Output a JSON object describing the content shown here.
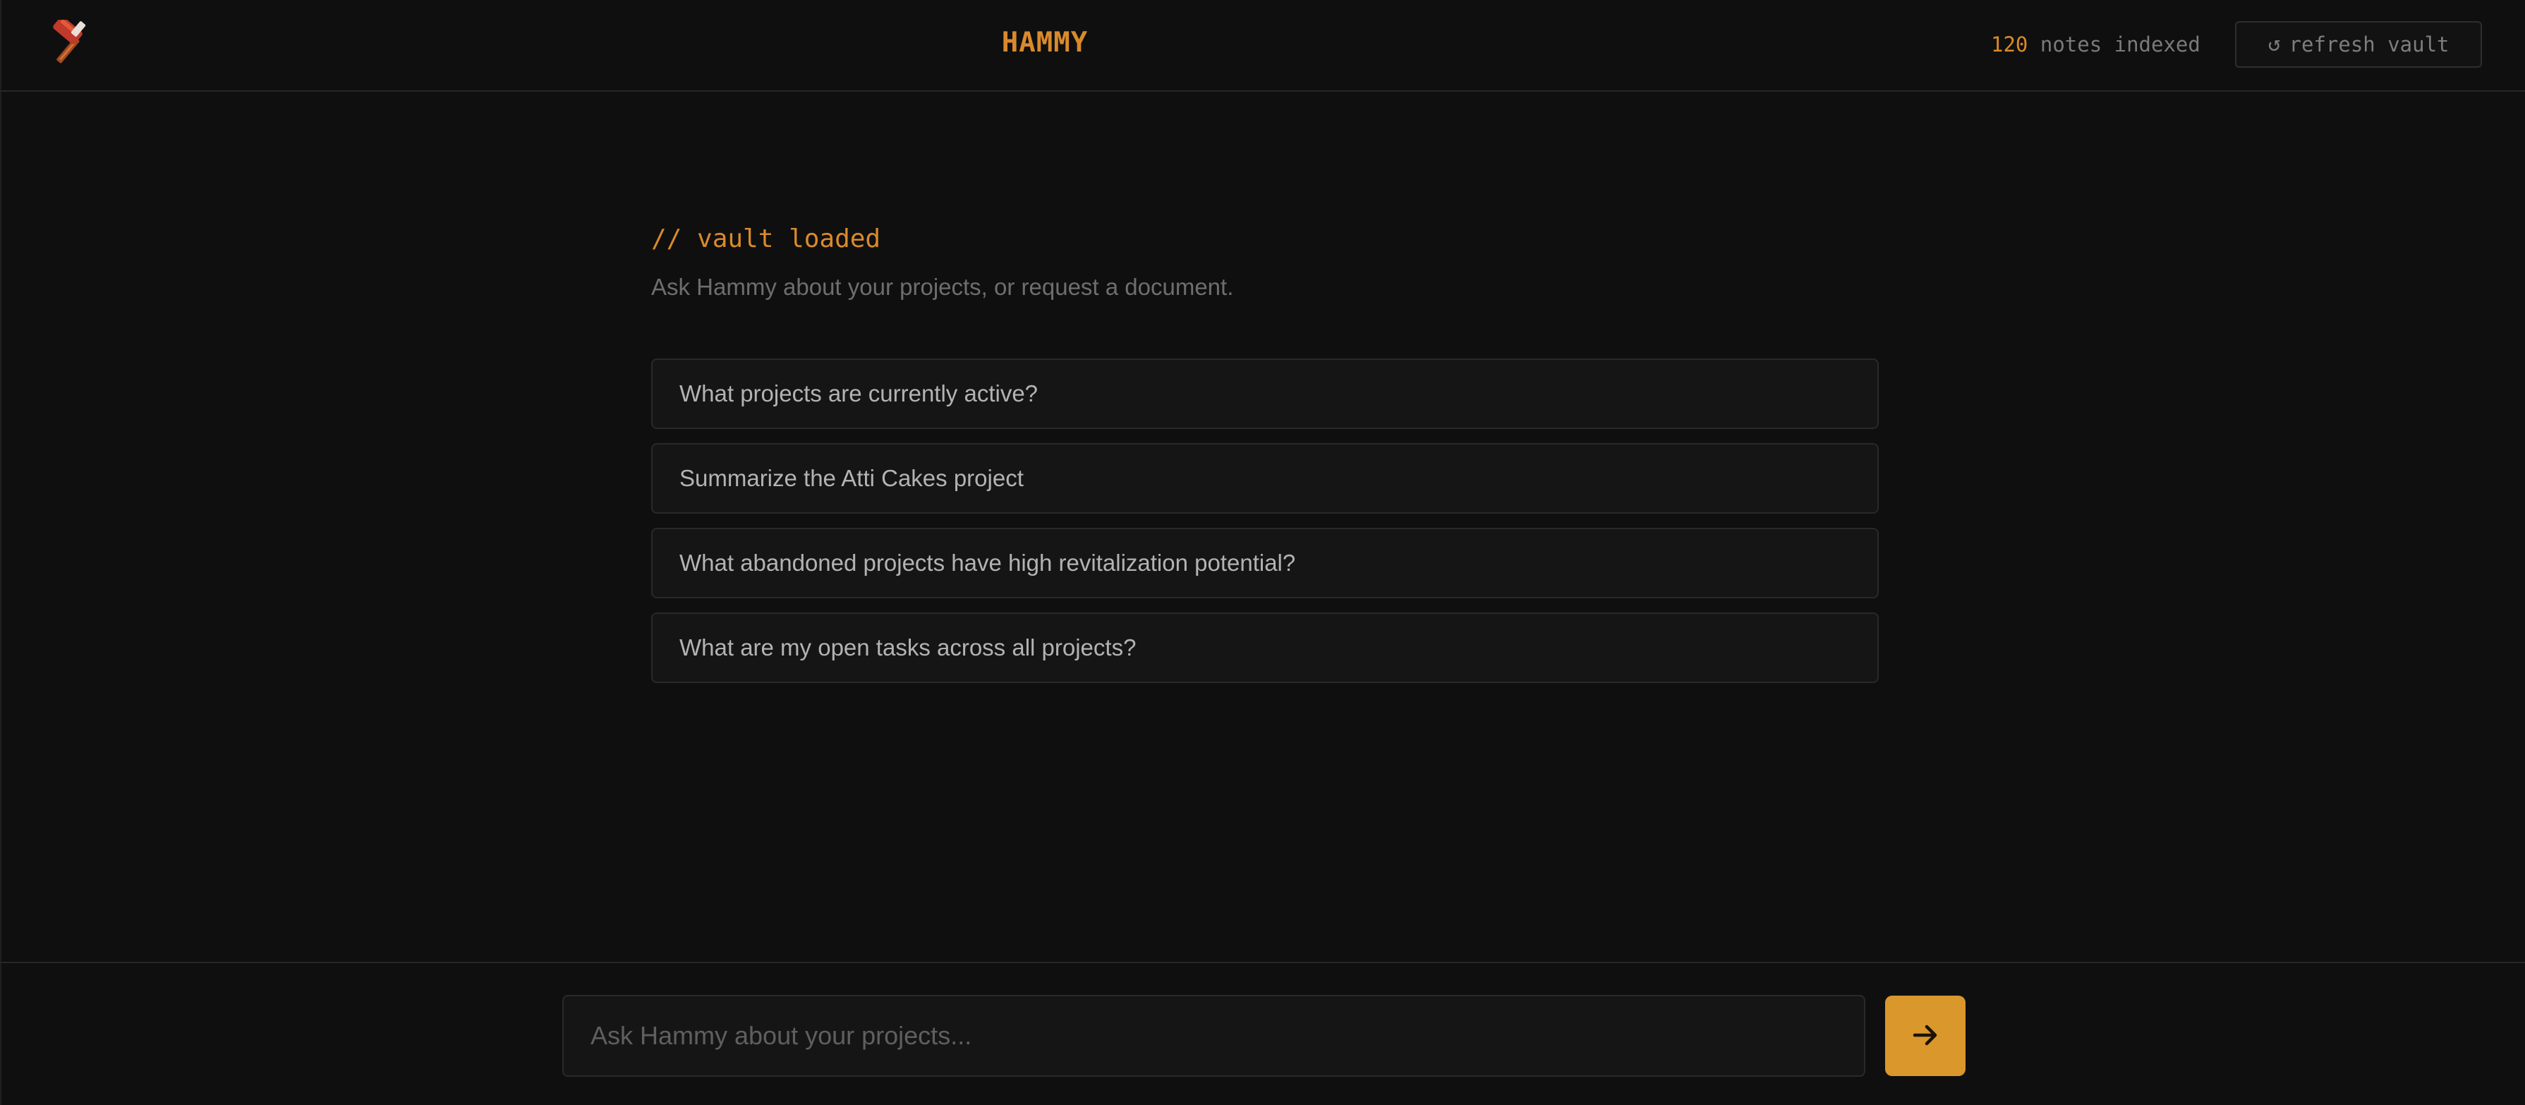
{
  "header": {
    "title": "HAMMY",
    "notes_count": "120",
    "notes_label": "notes indexed",
    "refresh_icon": "↺",
    "refresh_label": "refresh vault"
  },
  "main": {
    "heading": "// vault loaded",
    "subtitle": "Ask Hammy about your projects, or request a document.",
    "suggestions": [
      "What projects are currently active?",
      "Summarize the Atti Cakes project",
      "What abandoned projects have high revitalization potential?",
      "What are my open tasks across all projects?"
    ]
  },
  "input": {
    "placeholder": "Ask Hammy about your projects...",
    "value": ""
  },
  "icons": {
    "logo": "hammer-icon",
    "send": "arrow-right-icon"
  },
  "colors": {
    "accent": "#d98a2c",
    "button": "#d9972c",
    "background": "#0f0f0f"
  }
}
